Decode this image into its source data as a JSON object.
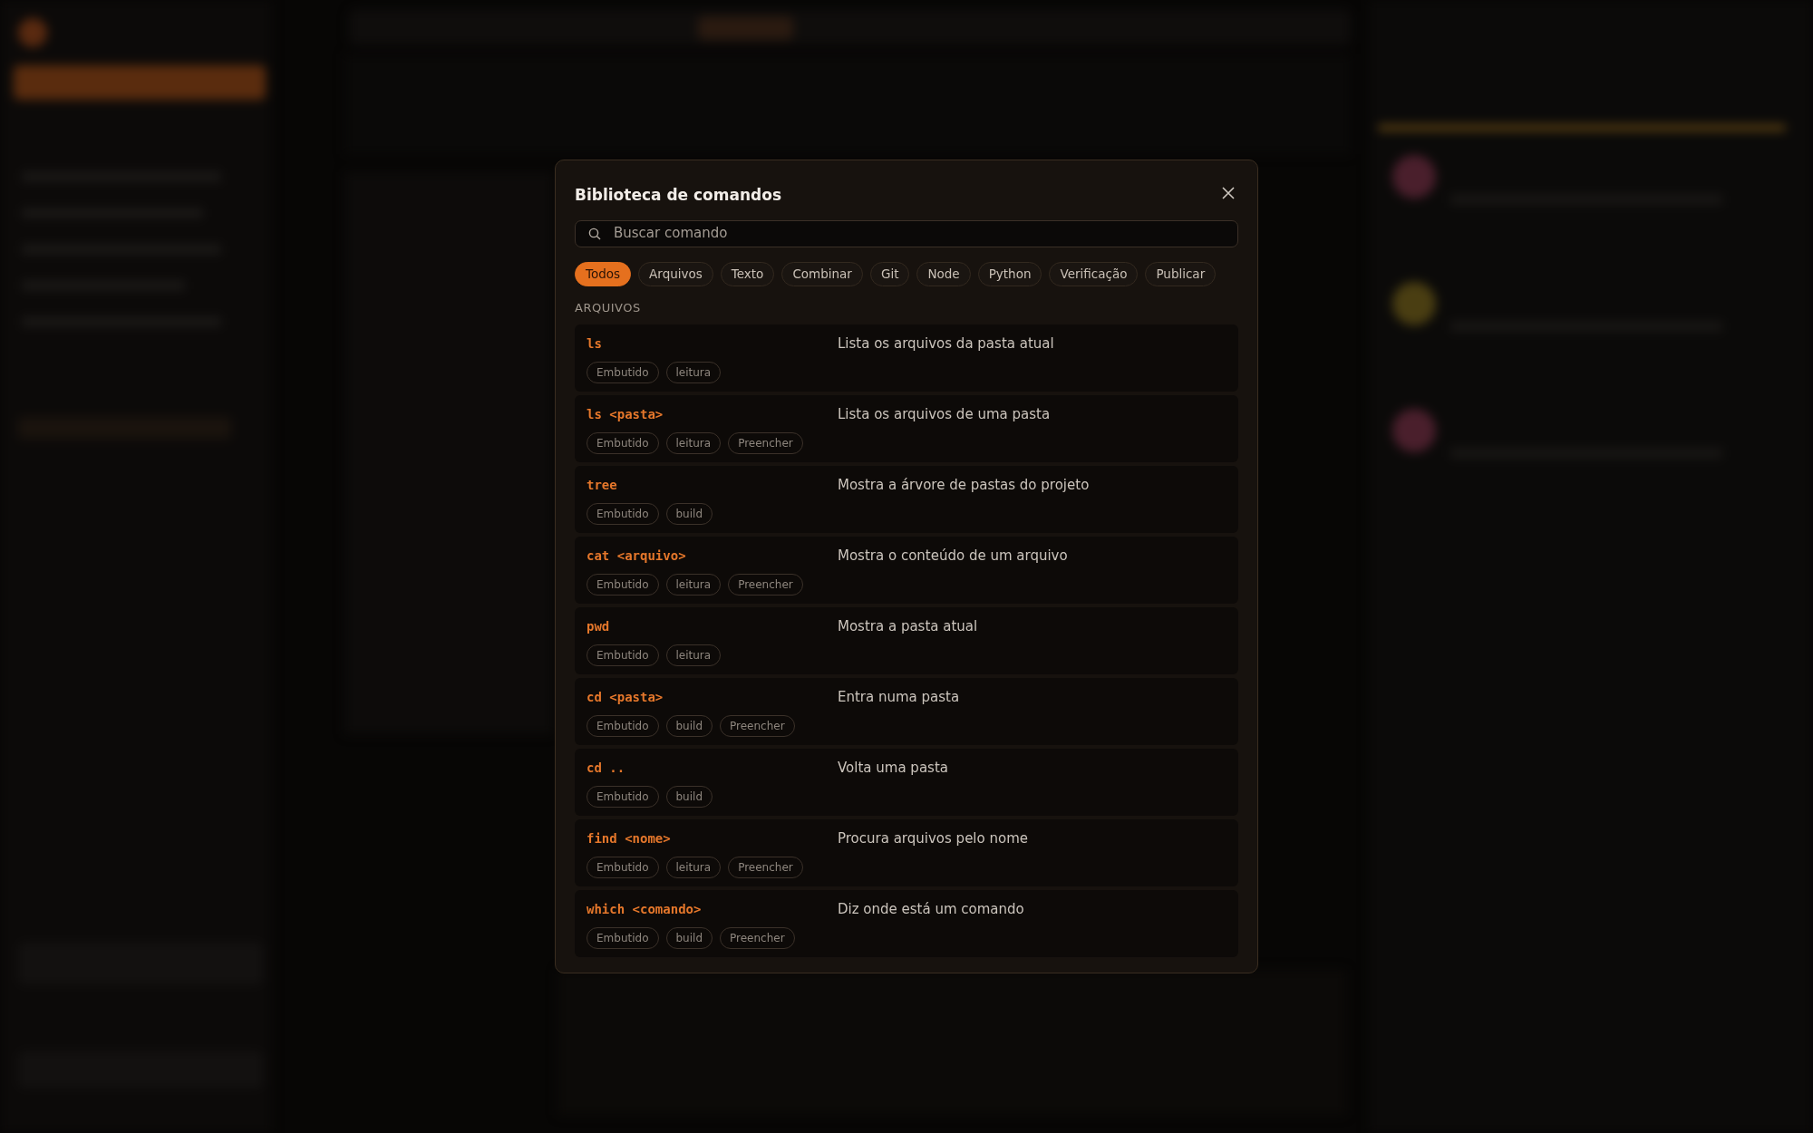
{
  "modal": {
    "title": "Biblioteca de comandos",
    "search": {
      "placeholder": "Buscar comando"
    },
    "filters": [
      {
        "label": "Todos",
        "selected": true
      },
      {
        "label": "Arquivos",
        "selected": false
      },
      {
        "label": "Texto",
        "selected": false
      },
      {
        "label": "Combinar",
        "selected": false
      },
      {
        "label": "Git",
        "selected": false
      },
      {
        "label": "Node",
        "selected": false
      },
      {
        "label": "Python",
        "selected": false
      },
      {
        "label": "Verificação",
        "selected": false
      },
      {
        "label": "Publicar",
        "selected": false
      }
    ],
    "section": "ARQUIVOS",
    "commands": [
      {
        "command": "ls",
        "description": "Lista os arquivos da pasta atual",
        "tags": [
          "Embutido",
          "leitura"
        ]
      },
      {
        "command": "ls <pasta>",
        "description": "Lista os arquivos de uma pasta",
        "tags": [
          "Embutido",
          "leitura",
          "Preencher"
        ]
      },
      {
        "command": "tree",
        "description": "Mostra a árvore de pastas do projeto",
        "tags": [
          "Embutido",
          "build"
        ]
      },
      {
        "command": "cat <arquivo>",
        "description": "Mostra o conteúdo de um arquivo",
        "tags": [
          "Embutido",
          "leitura",
          "Preencher"
        ]
      },
      {
        "command": "pwd",
        "description": "Mostra a pasta atual",
        "tags": [
          "Embutido",
          "leitura"
        ]
      },
      {
        "command": "cd <pasta>",
        "description": "Entra numa pasta",
        "tags": [
          "Embutido",
          "build",
          "Preencher"
        ]
      },
      {
        "command": "cd ..",
        "description": "Volta uma pasta",
        "tags": [
          "Embutido",
          "build"
        ]
      },
      {
        "command": "find <nome>",
        "description": "Procura arquivos pelo nome",
        "tags": [
          "Embutido",
          "leitura",
          "Preencher"
        ]
      },
      {
        "command": "which <comando>",
        "description": "Diz onde está um comando",
        "tags": [
          "Embutido",
          "build",
          "Preencher"
        ]
      }
    ]
  }
}
